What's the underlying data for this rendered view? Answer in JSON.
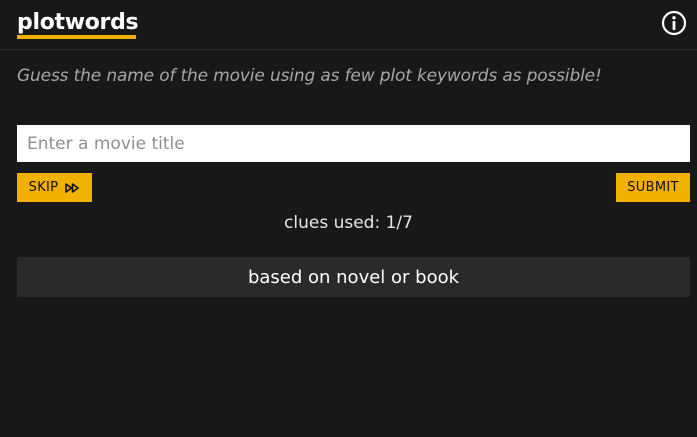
{
  "header": {
    "logo_text": "plotwords",
    "info_icon": "info-circle-icon"
  },
  "tagline": "Guess the name of the movie using as few plot keywords as possible!",
  "search": {
    "placeholder": "Enter a movie title",
    "value": ""
  },
  "actions": {
    "skip_label": "SKIP",
    "skip_icon": "fast-forward-icon",
    "submit_label": "SUBMIT"
  },
  "clues_used": "clues used: 1/7",
  "clues": [
    {
      "text": "based on novel or book"
    }
  ],
  "colors": {
    "background": "#181818",
    "accent": "#f2b000",
    "clue_background": "#2a2a2a",
    "tagline_text": "#a7a7a7"
  }
}
